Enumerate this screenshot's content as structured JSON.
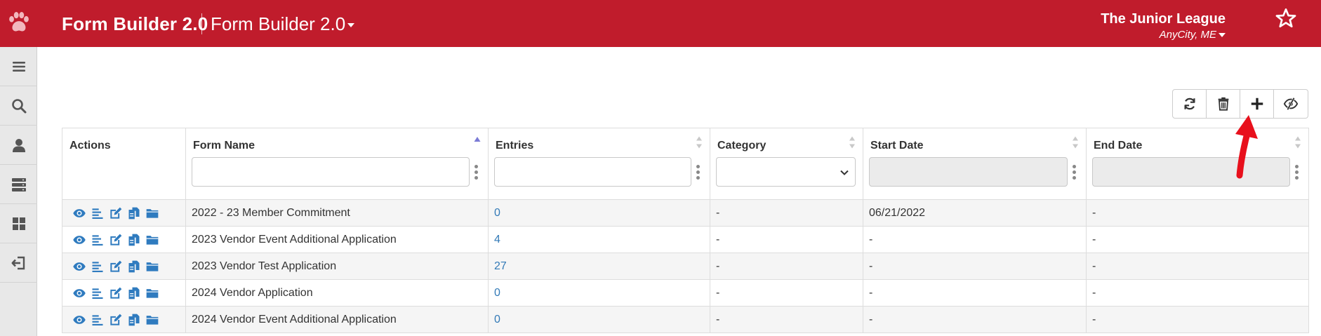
{
  "header": {
    "brand": "Form Builder 2.0",
    "app_switcher_label": "Form Builder 2.0",
    "org_name": "The Junior League",
    "org_location": "AnyCity, ME"
  },
  "sidebar": {
    "items": [
      {
        "name": "menu-icon"
      },
      {
        "name": "search-icon"
      },
      {
        "name": "user-icon"
      },
      {
        "name": "server-icon"
      },
      {
        "name": "dashboard-icon"
      },
      {
        "name": "logout-icon"
      }
    ]
  },
  "toolbar": {
    "buttons": [
      {
        "name": "refresh-icon"
      },
      {
        "name": "trash-icon"
      },
      {
        "name": "plus-icon"
      },
      {
        "name": "eye-slash-icon"
      }
    ]
  },
  "table": {
    "columns": {
      "actions": "Actions",
      "form_name": "Form Name",
      "entries": "Entries",
      "category": "Category",
      "start_date": "Start Date",
      "end_date": "End Date"
    },
    "rows": [
      {
        "form_name": "2022 - 23 Member Commitment",
        "entries": "0",
        "category": "-",
        "start_date": "06/21/2022",
        "end_date": "-"
      },
      {
        "form_name": "2023 Vendor Event Additional Application",
        "entries": "4",
        "category": "-",
        "start_date": "-",
        "end_date": "-"
      },
      {
        "form_name": "2023 Vendor Test Application",
        "entries": "27",
        "category": "-",
        "start_date": "-",
        "end_date": "-"
      },
      {
        "form_name": "2024 Vendor Application",
        "entries": "0",
        "category": "-",
        "start_date": "-",
        "end_date": "-"
      },
      {
        "form_name": "2024 Vendor Event Additional Application",
        "entries": "0",
        "category": "-",
        "start_date": "-",
        "end_date": "-"
      }
    ]
  },
  "colors": {
    "brand_red": "#c01c2c",
    "link_blue": "#337ab7",
    "icon_blue": "#2f7bbf",
    "annotation_red": "#e8101c"
  }
}
